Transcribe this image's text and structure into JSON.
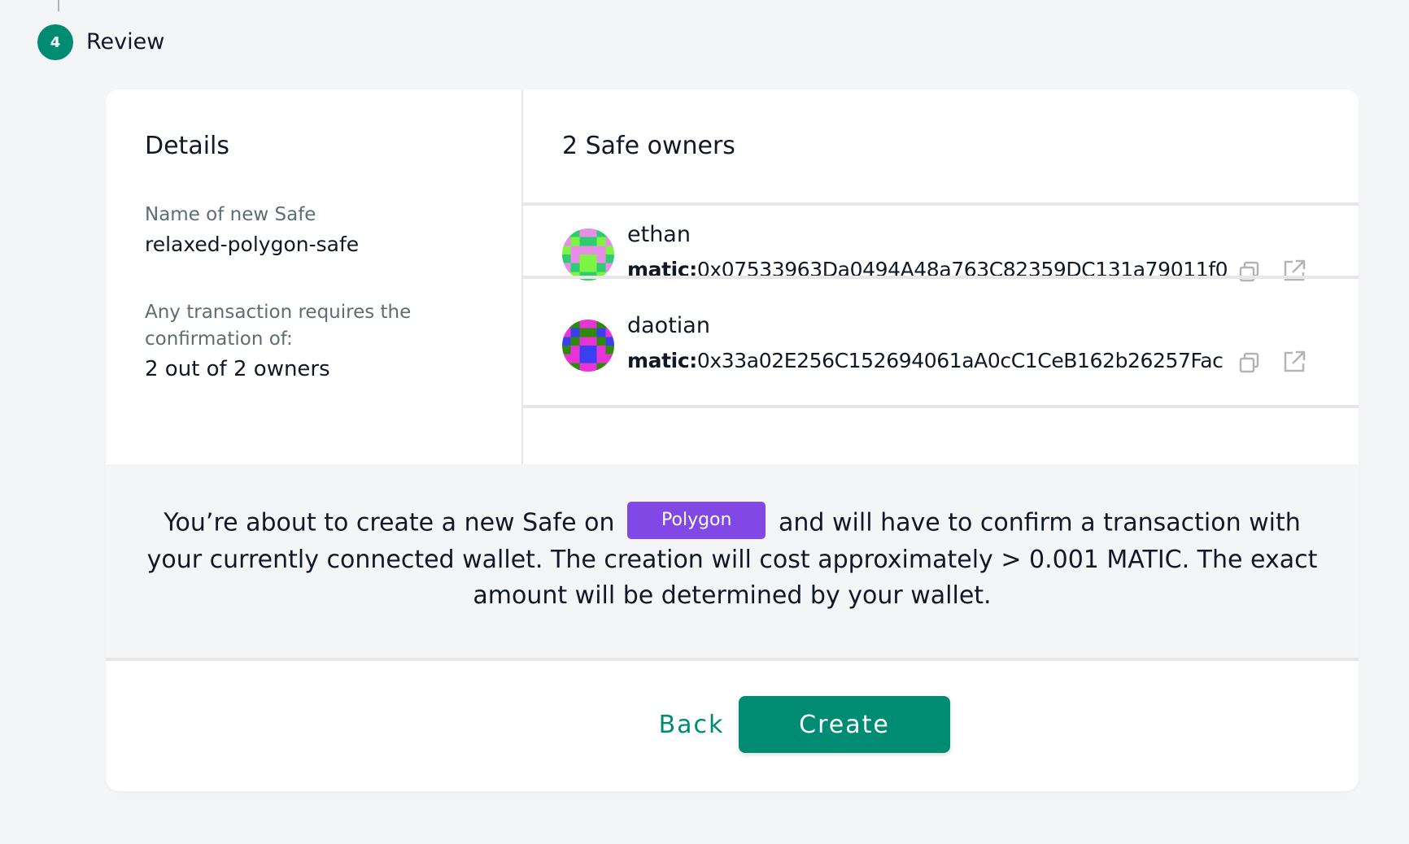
{
  "stepper": {
    "number": "4",
    "label": "Review"
  },
  "details": {
    "title": "Details",
    "name_label": "Name of new Safe",
    "name_value": "relaxed-polygon-safe",
    "threshold_label": "Any transaction requires the confirmation of:",
    "threshold_value": "2 out of 2 owners"
  },
  "owners": {
    "title": "2 Safe owners",
    "items": [
      {
        "name": "ethan",
        "prefix": "matic:",
        "address": "0x07533963Da0494A48a763C82359DC131a79011f0",
        "avatar_colors": [
          "#2ecc71",
          "#e88ee6",
          "#7cf542"
        ]
      },
      {
        "name": "daotian",
        "prefix": "matic:",
        "address": "0x33a02E256C152694061aA0cC1CeB162b26257Fac",
        "avatar_colors": [
          "#e933d6",
          "#2e8b0a",
          "#3b3ff0"
        ]
      }
    ]
  },
  "notice": {
    "before": "You’re about to create a new Safe on",
    "network": "Polygon",
    "after": "and will have to confirm a transaction with your currently connected wallet. The creation will cost approximately > 0.001 MATIC. The exact amount will be determined by your wallet."
  },
  "actions": {
    "back_label": "Back",
    "create_label": "Create"
  },
  "colors": {
    "accent": "#008c73",
    "network_badge": "#8248e5"
  },
  "icons": {
    "copy": "copy-icon",
    "external_link": "external-link-icon"
  }
}
